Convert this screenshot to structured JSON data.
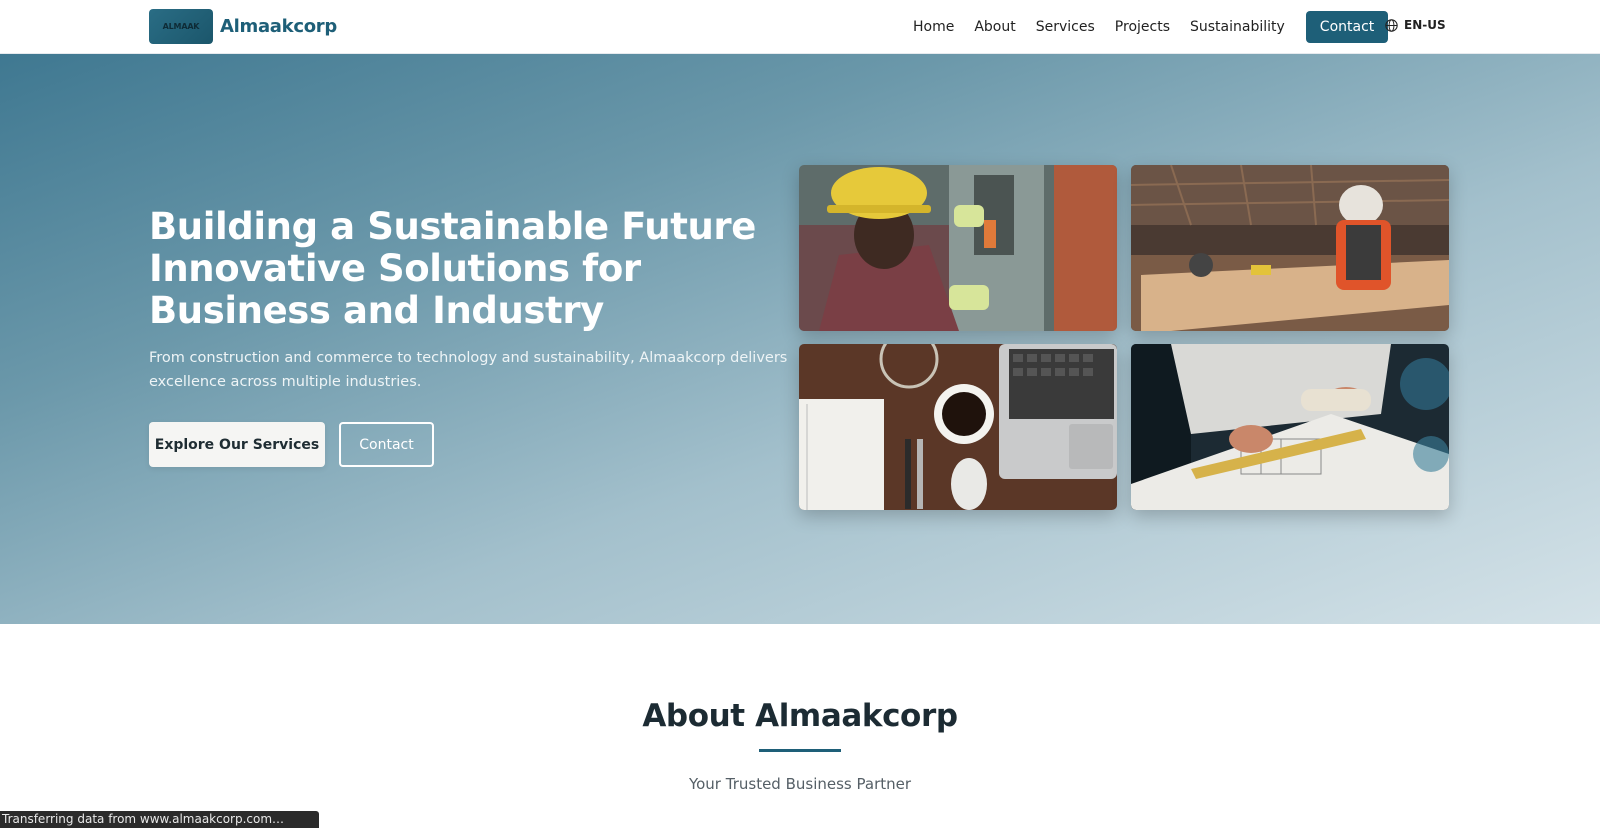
{
  "brand": {
    "logo_text": "ALMAAK",
    "name": "Almaakcorp",
    "color": "#1e5f78"
  },
  "nav": {
    "links": [
      "Home",
      "About",
      "Services",
      "Projects",
      "Sustainability"
    ],
    "contact_label": "Contact",
    "language": "EN-US"
  },
  "hero": {
    "title": "Building a Sustainable Future Innovative Solutions for Business and Industry",
    "subtitle": "From construction and commerce to technology and sustainability, Almaakcorp delivers excellence across multiple industries.",
    "primary_button": "Explore Our Services",
    "secondary_button": "Contact",
    "images": [
      "worker-hardhat-electrical-photo",
      "carpenter-workshop-photo",
      "desk-laptop-coffee-photo",
      "architect-blueprint-photo"
    ]
  },
  "about": {
    "title": "About Almaakcorp",
    "subtitle": "Your Trusted Business Partner"
  },
  "status_bar": {
    "text": "Transferring data from www.almaakcorp.com…"
  },
  "colors": {
    "accent": "#1e5f78",
    "hero_start": "#3f7891",
    "hero_end": "#d4e2e8"
  }
}
